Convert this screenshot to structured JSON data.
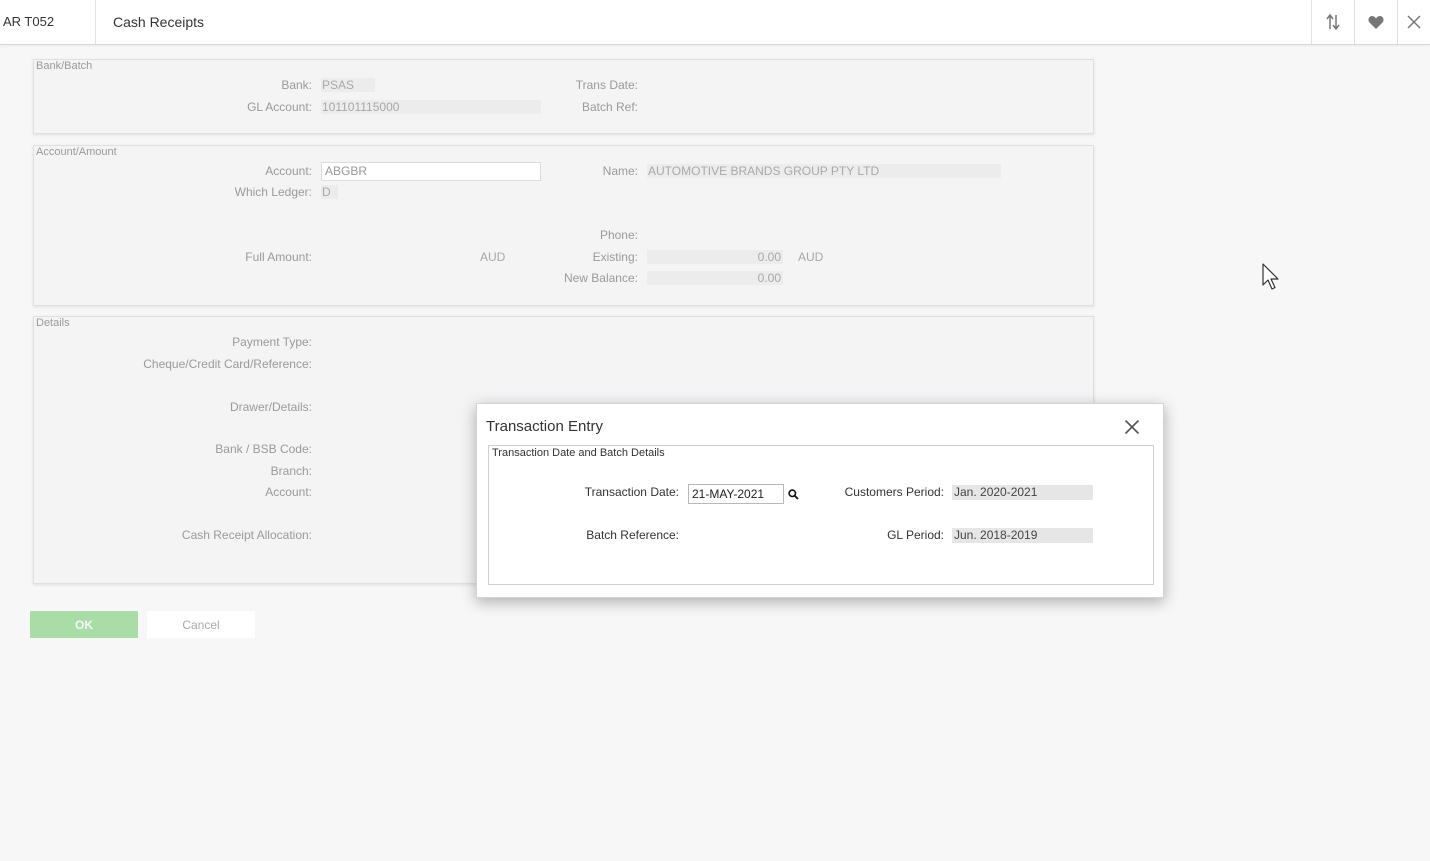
{
  "header": {
    "code": "AR T052",
    "title": "Cash Receipts"
  },
  "bank_batch": {
    "legend": "Bank/Batch",
    "bank_label": "Bank:",
    "bank_value": "PSAS",
    "gl_account_label": "GL Account:",
    "gl_account_value": "101101115000",
    "trans_date_label": "Trans Date:",
    "batch_ref_label": "Batch Ref:"
  },
  "account_amount": {
    "legend": "Account/Amount",
    "account_label": "Account:",
    "account_value": "ABGBR",
    "which_ledger_label": "Which Ledger:",
    "which_ledger_value": "D",
    "name_label": "Name:",
    "name_value": "AUTOMOTIVE BRANDS GROUP PTY LTD",
    "phone_label": "Phone:",
    "full_amount_label": "Full Amount:",
    "full_amount_currency": "AUD",
    "existing_label": "Existing:",
    "existing_value": "0.00",
    "existing_currency": "AUD",
    "new_balance_label": "New Balance:",
    "new_balance_value": "0.00"
  },
  "details": {
    "legend": "Details",
    "payment_type_label": "Payment Type:",
    "cheque_label": "Cheque/Credit Card/Reference:",
    "drawer_label": "Drawer/Details:",
    "bsb_label": "Bank / BSB Code:",
    "branch_label": "Branch:",
    "account_label": "Account:",
    "allocation_label": "Cash Receipt Allocation:"
  },
  "buttons": {
    "ok": "OK",
    "cancel": "Cancel"
  },
  "modal": {
    "title": "Transaction Entry",
    "fieldset_legend": "Transaction Date and Batch Details",
    "transaction_date_label": "Transaction Date:",
    "transaction_date_value": "21-MAY-2021",
    "batch_reference_label": "Batch Reference:",
    "customers_period_label": "Customers Period:",
    "customers_period_value": "Jan. 2020-2021",
    "gl_period_label": "GL Period:",
    "gl_period_value": "Jun. 2018-2019"
  },
  "icons": {
    "sort": "sort-arrows-icon",
    "favorite": "heart-icon",
    "close": "close-icon",
    "search": "search-icon",
    "cursor": "mouse-cursor-icon"
  },
  "colors": {
    "ok_button": "#a9dca7",
    "background": "#f7f7f8"
  }
}
